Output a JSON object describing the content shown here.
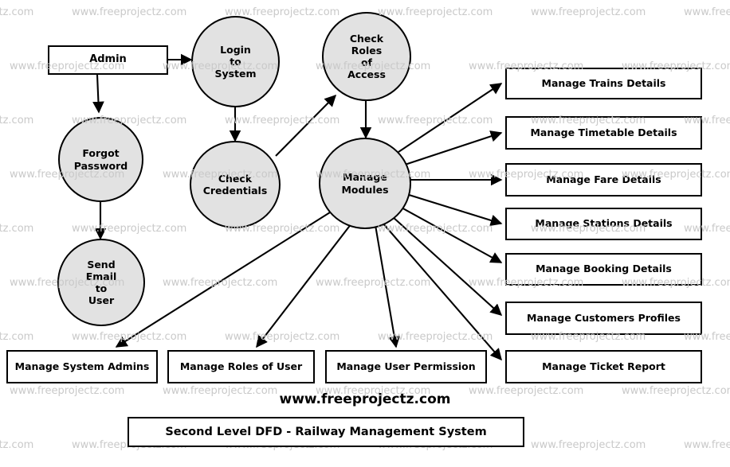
{
  "diagram": {
    "title": "Second Level DFD - Railway Management System",
    "site_credit": "www.freeprojectz.com",
    "watermark_text": "www.freeprojectz.com",
    "colors": {
      "process_fill": "#e2e2e2",
      "entity_fill": "#ffffff",
      "stroke": "#000000",
      "watermark": "#c9c9c9",
      "background": "#ffffff"
    }
  },
  "entities": [
    {
      "id": "admin",
      "label": "Admin"
    }
  ],
  "processes": [
    {
      "id": "login_to_system",
      "label": "Login\nto\nSystem"
    },
    {
      "id": "check_roles_of_access",
      "label": "Check\nRoles\nof\nAccess"
    },
    {
      "id": "forgot_password",
      "label": "Forgot\nPassword"
    },
    {
      "id": "check_credentials",
      "label": "Check\nCredentials"
    },
    {
      "id": "manage_modules",
      "label": "Manage\nModules"
    },
    {
      "id": "send_email_to_user",
      "label": "Send\nEmail\nto\nUser"
    }
  ],
  "right_modules": [
    {
      "id": "manage_trains_details",
      "label": "Manage Trains Details"
    },
    {
      "id": "manage_timetable_details",
      "label": "Manage Timetable Details"
    },
    {
      "id": "manage_fare_details",
      "label": "Manage Fare Details"
    },
    {
      "id": "manage_stations_details",
      "label": "Manage Stations Details"
    },
    {
      "id": "manage_booking_details",
      "label": "Manage Booking Details"
    },
    {
      "id": "manage_customers_profiles",
      "label": "Manage Customers Profiles"
    },
    {
      "id": "manage_ticket_report",
      "label": "Manage Ticket Report"
    }
  ],
  "bottom_modules": [
    {
      "id": "manage_system_admins",
      "label": "Manage System Admins"
    },
    {
      "id": "manage_roles_of_user",
      "label": "Manage Roles of User"
    },
    {
      "id": "manage_user_permission",
      "label": "Manage User Permission"
    }
  ],
  "flows": [
    {
      "from": "admin",
      "to": "login_to_system"
    },
    {
      "from": "admin",
      "to": "forgot_password"
    },
    {
      "from": "login_to_system",
      "to": "check_credentials"
    },
    {
      "from": "check_credentials",
      "to": "check_roles_of_access"
    },
    {
      "from": "check_roles_of_access",
      "to": "manage_modules"
    },
    {
      "from": "forgot_password",
      "to": "send_email_to_user"
    },
    {
      "from": "manage_modules",
      "to": "manage_trains_details"
    },
    {
      "from": "manage_modules",
      "to": "manage_timetable_details"
    },
    {
      "from": "manage_modules",
      "to": "manage_fare_details"
    },
    {
      "from": "manage_modules",
      "to": "manage_stations_details"
    },
    {
      "from": "manage_modules",
      "to": "manage_booking_details"
    },
    {
      "from": "manage_modules",
      "to": "manage_customers_profiles"
    },
    {
      "from": "manage_modules",
      "to": "manage_ticket_report"
    },
    {
      "from": "manage_modules",
      "to": "manage_system_admins"
    },
    {
      "from": "manage_modules",
      "to": "manage_roles_of_user"
    },
    {
      "from": "manage_modules",
      "to": "manage_user_permission"
    }
  ]
}
